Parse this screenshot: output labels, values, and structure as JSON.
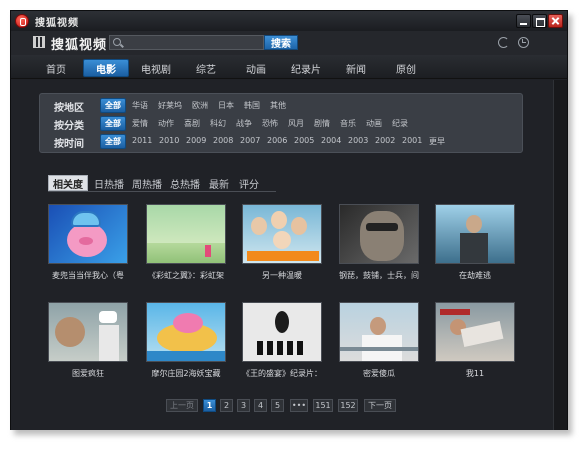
{
  "window": {
    "title": "搜狐视频"
  },
  "header": {
    "logo": "搜狐视频",
    "search_placeholder": "",
    "search_button": "搜索"
  },
  "nav": {
    "tabs": [
      "首页",
      "电影",
      "电视剧",
      "综艺",
      "动画",
      "纪录片",
      "新闻",
      "原创"
    ],
    "active": "电影"
  },
  "filters": [
    {
      "label": "按地区",
      "options": [
        "全部",
        "华语",
        "好莱坞",
        "欧洲",
        "日本",
        "韩国",
        "其他"
      ]
    },
    {
      "label": "按分类",
      "options": [
        "全部",
        "爱情",
        "动作",
        "喜剧",
        "科幻",
        "战争",
        "恐怖",
        "风月",
        "剧情",
        "音乐",
        "动画",
        "纪录"
      ]
    },
    {
      "label": "按时间",
      "options": [
        "全部",
        "2011",
        "2010",
        "2009",
        "2008",
        "2007",
        "2006",
        "2005",
        "2004",
        "2003",
        "2002",
        "2001",
        "更早"
      ]
    }
  ],
  "sort_tabs": [
    "相关度",
    "日热播",
    "周热播",
    "总热播",
    "最新",
    "评分"
  ],
  "videos": [
    "麦兜当当伴我心（粤",
    "《彩虹之翼》：彩虹架",
    "另一种温暖",
    "钢琵，鼓铺，士兵，间",
    "在劫难逃",
    "图爱疯狂",
    "摩尔庄园2海妖宝藏",
    "《王的盛宴》纪录片：",
    "密爱傻瓜",
    "我11"
  ],
  "pagination": {
    "prev": "上一页",
    "pages": [
      "1",
      "2",
      "3",
      "4",
      "5",
      "•••",
      "151",
      "152"
    ],
    "next": "下一页",
    "active": "1"
  }
}
